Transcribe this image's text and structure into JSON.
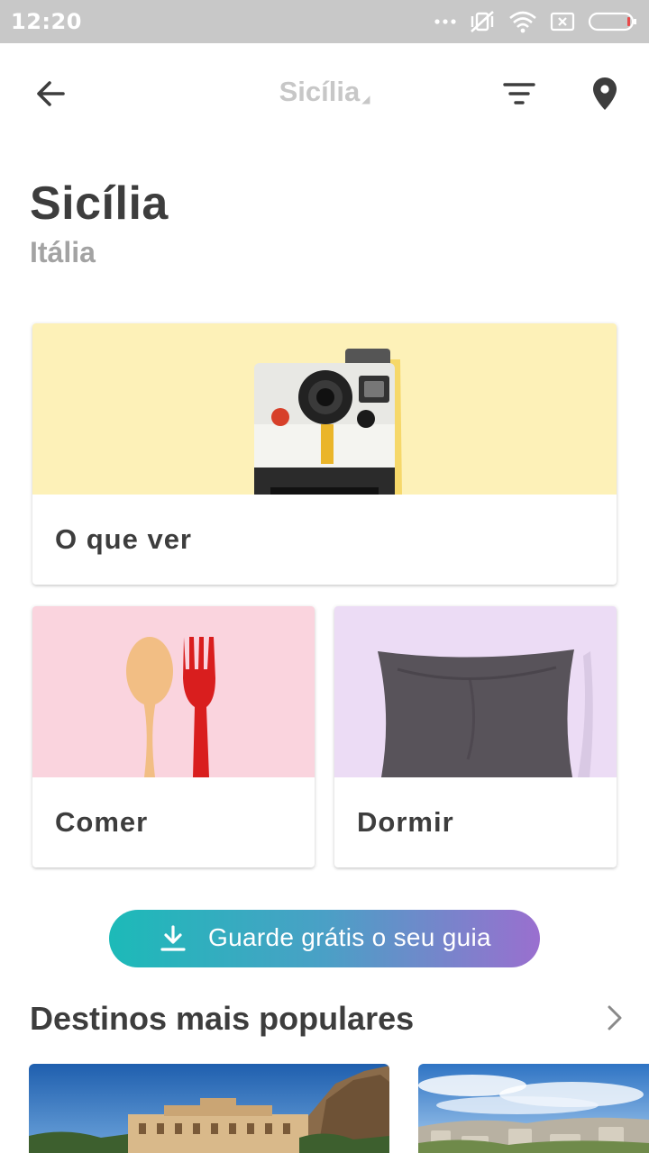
{
  "status_bar": {
    "time": "12:20",
    "icons": [
      "dots-icon",
      "vibrate-off-icon",
      "wifi-icon",
      "sim-x-icon",
      "battery-icon"
    ]
  },
  "app_bar": {
    "title": "Sicília",
    "caret": "◢",
    "icons": [
      "back-arrow-icon",
      "filter-icon",
      "map-pin-icon"
    ]
  },
  "header": {
    "title": "Sicília",
    "subtitle": "Itália"
  },
  "categories": [
    {
      "label": "O que ver",
      "image": "polaroid-camera",
      "bg_color": "#fdf1b8"
    },
    {
      "label": "Comer",
      "image": "spoon-and-fork",
      "bg_color": "#fad4de"
    },
    {
      "label": "Dormir",
      "image": "pillow",
      "bg_color": "#ecdcf5"
    }
  ],
  "save_button": {
    "label": "Guarde grátis o seu guia",
    "icon": "download-icon",
    "gradient": [
      "#1cbab8",
      "#9a6fcf"
    ]
  },
  "popular": {
    "title": "Destinos mais populares",
    "items": [
      {
        "image": "palermo-palace-photo"
      },
      {
        "image": "ancient-ruins-photo"
      }
    ]
  },
  "colors": {
    "text_primary": "#3d3d3d",
    "text_secondary": "#a3a3a3",
    "app_bar_title": "#c7c7c7",
    "status_bar_bg": "#c8c8c8"
  }
}
